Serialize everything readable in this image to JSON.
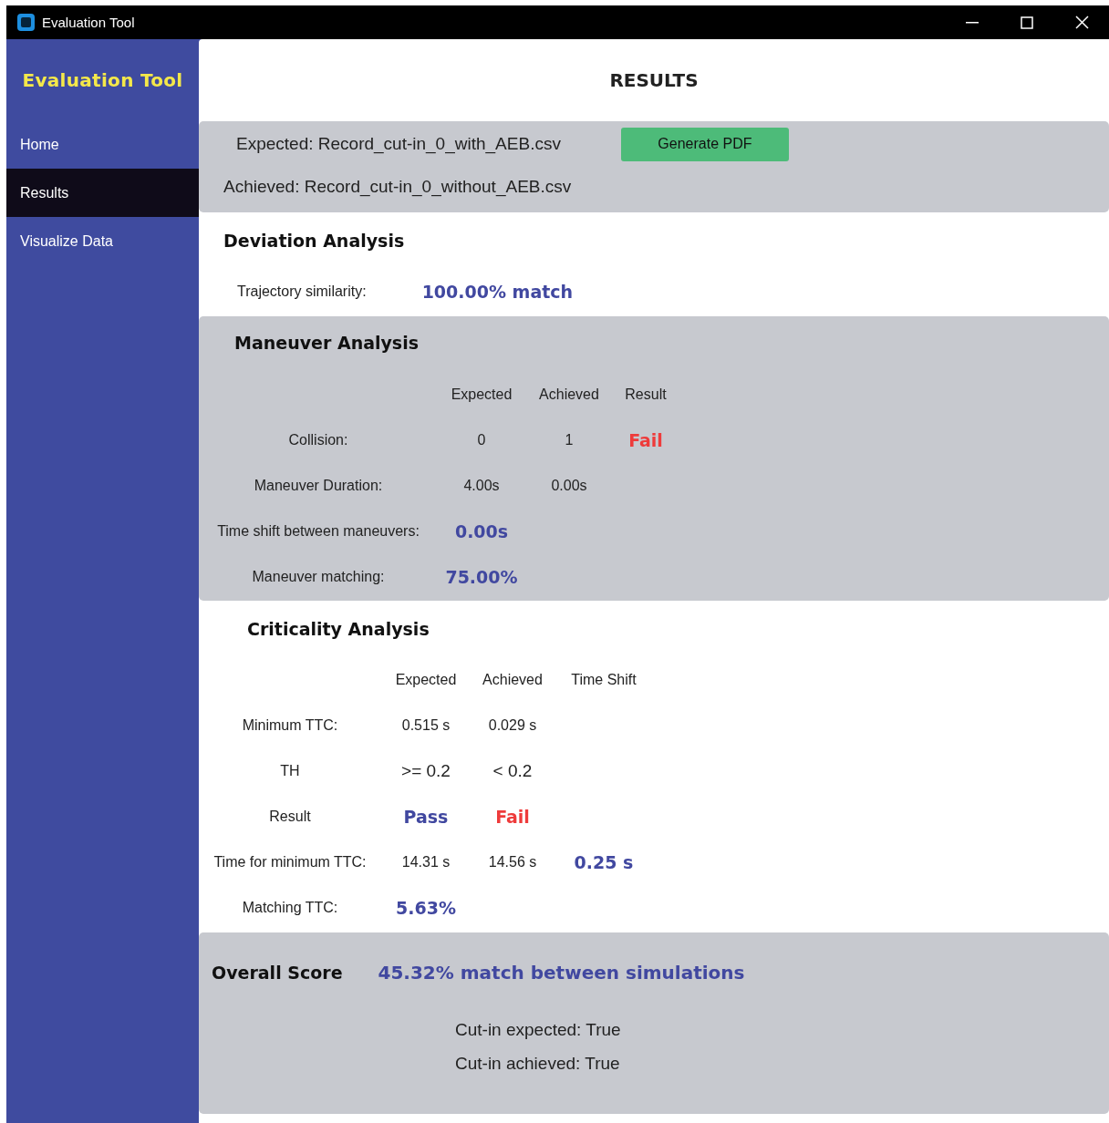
{
  "window": {
    "title": "Evaluation Tool"
  },
  "sidebar": {
    "title": "Evaluation Tool",
    "items": [
      {
        "label": "Home",
        "selected": false
      },
      {
        "label": "Results",
        "selected": true
      },
      {
        "label": "Visualize Data",
        "selected": false
      }
    ]
  },
  "page_title": "RESULTS",
  "files": {
    "expected": "Expected: Record_cut-in_0_with_AEB.csv",
    "achieved": "Achieved: Record_cut-in_0_without_AEB.csv",
    "button": "Generate PDF"
  },
  "deviation": {
    "heading": "Deviation Analysis",
    "label": "Trajectory similarity:",
    "value": "100.00% match"
  },
  "maneuver": {
    "heading": "Maneuver Analysis",
    "columns": [
      "Expected",
      "Achieved",
      "Result"
    ],
    "rows": [
      {
        "label": "Collision:",
        "cells": [
          {
            "text": "0",
            "kind": "plain"
          },
          {
            "text": "1",
            "kind": "plain"
          },
          {
            "text": "Fail",
            "kind": "fail"
          }
        ]
      },
      {
        "label": "Maneuver Duration:",
        "cells": [
          {
            "text": "4.00s",
            "kind": "plain"
          },
          {
            "text": "0.00s",
            "kind": "plain"
          }
        ]
      },
      {
        "label": "Time shift between maneuvers:",
        "cells": [
          {
            "text": "0.00s",
            "kind": "metric"
          }
        ]
      },
      {
        "label": "Maneuver matching:",
        "cells": [
          {
            "text": "75.00%",
            "kind": "metric"
          }
        ]
      }
    ]
  },
  "criticality": {
    "heading": "Criticality Analysis",
    "columns": [
      "Expected",
      "Achieved",
      "Time Shift"
    ],
    "rows": [
      {
        "label": "Minimum TTC:",
        "cells": [
          {
            "text": "0.515 s",
            "kind": "plain"
          },
          {
            "text": "0.029 s",
            "kind": "plain"
          }
        ]
      },
      {
        "label": "TH",
        "cells": [
          {
            "text": ">= 0.2",
            "kind": "large"
          },
          {
            "text": "< 0.2",
            "kind": "large"
          }
        ]
      },
      {
        "label": "Result",
        "cells": [
          {
            "text": "Pass",
            "kind": "pass"
          },
          {
            "text": "Fail",
            "kind": "fail"
          }
        ]
      },
      {
        "label": "Time for minimum TTC:",
        "cells": [
          {
            "text": "14.31 s",
            "kind": "plain"
          },
          {
            "text": "14.56 s",
            "kind": "plain"
          },
          {
            "text": "0.25 s",
            "kind": "metric"
          }
        ]
      },
      {
        "label": "Matching TTC:",
        "cells": [
          {
            "text": "5.63%",
            "kind": "metric"
          }
        ]
      }
    ]
  },
  "overall": {
    "heading": "Overall Score",
    "value": "45.32% match between simulations",
    "notes": [
      "Cut-in expected: True",
      "Cut-in achieved: True"
    ]
  }
}
